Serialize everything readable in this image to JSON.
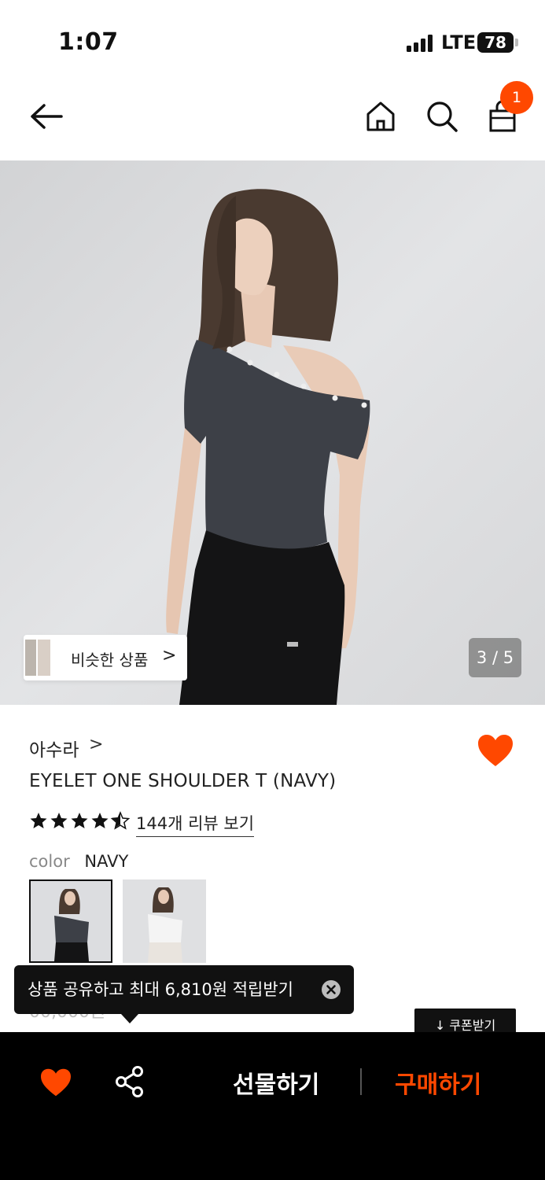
{
  "status_bar": {
    "time": "1:07",
    "network": "LTE",
    "battery": "78"
  },
  "nav": {
    "cart_count": "1"
  },
  "hero": {
    "similar_label": "비슷한 상품",
    "similar_arrow": ">",
    "page_indicator": "3 / 5"
  },
  "product": {
    "brand": "아수라",
    "brand_arrow": ">",
    "name": "EYELET ONE SHOULDER T (NAVY)",
    "rating": 4.5,
    "review_link": "144개 리뷰 보기",
    "color_label": "color",
    "color_value": "NAVY",
    "price_partial": "00,000원",
    "coupon_label": "↓ 쿠폰받기"
  },
  "tooltip": {
    "text": "상품 공유하고 최대 6,810원 적립받기"
  },
  "bottom_bar": {
    "gift_label": "선물하기",
    "buy_label": "구매하기"
  },
  "colors": {
    "accent": "#ff4800",
    "bar": "#000000",
    "shirt_navy": "#3d4047"
  },
  "icons": {
    "back": "arrow-left-icon",
    "home": "home-icon",
    "search": "search-icon",
    "bag": "shopping-bag-icon",
    "heart": "heart-icon",
    "share": "share-icon",
    "close": "close-circle-icon"
  }
}
